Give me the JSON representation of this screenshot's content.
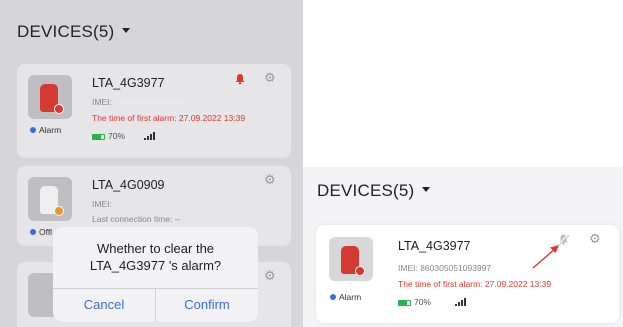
{
  "left": {
    "header_title": "DEVICES(5)",
    "cards": [
      {
        "name": "LTA_4G3977",
        "imei_label": "IMEI:",
        "info_line": "The time of first alarm: 27.09.2022 13:39",
        "battery": "70%",
        "battery_level": 70,
        "status": "Alarm",
        "status_color": "#3a6fd8"
      },
      {
        "name": "LTA_4G0909",
        "imei_label": "IMEI:",
        "info_line": "Last connection time: --",
        "status": "Offl",
        "status_color": "#3a6fd8"
      }
    ],
    "dialog": {
      "line1": "Whether to clear the",
      "line2": "LTA_4G3977 's alarm?",
      "cancel_label": "Cancel",
      "confirm_label": "Confirm"
    }
  },
  "right": {
    "header_title": "DEVICES(5)",
    "card": {
      "name": "LTA_4G3977",
      "imei": "IMEI: 860305051093997",
      "info_line": "The time of first alarm: 27.09.2022 13:39",
      "battery": "70%",
      "battery_level": 70,
      "status": "Alarm",
      "status_color": "#3a6fd8"
    }
  },
  "colors": {
    "alarm_red": "#e5352b",
    "accent_blue": "#3a6fd8",
    "battery_green": "#29b34a"
  },
  "icons": [
    "chevron-down-icon",
    "bell-alarm-icon",
    "bell-muted-icon",
    "gear-icon",
    "signal-icon",
    "battery-icon",
    "arrow-icon"
  ]
}
